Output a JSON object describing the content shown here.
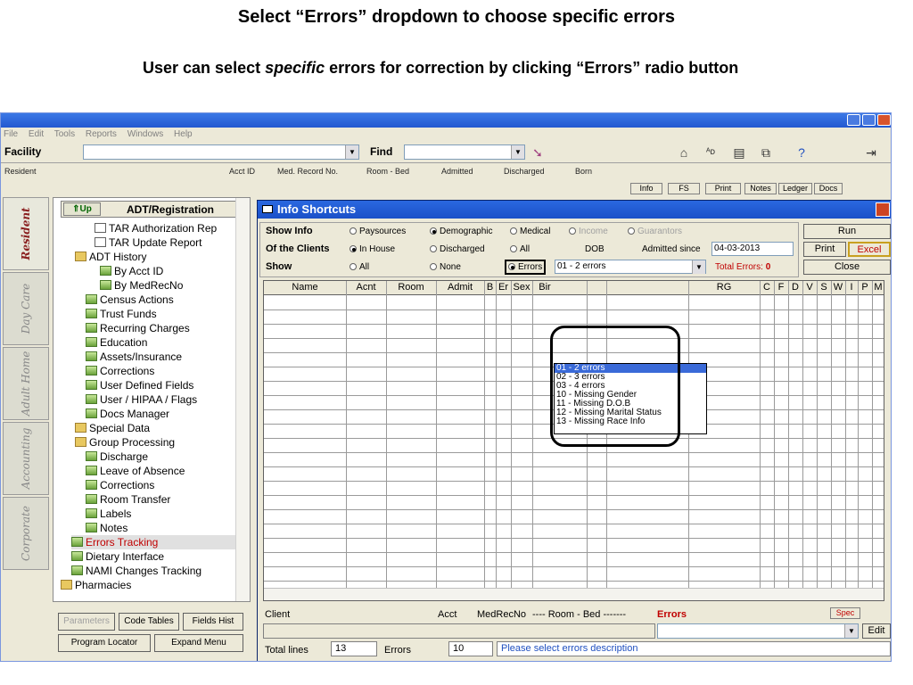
{
  "slide": {
    "title": "Select “Errors” dropdown to choose specific errors",
    "subtitle_pre": "User can select ",
    "subtitle_em": "specific",
    "subtitle_post": " errors for correction by clicking “Errors” radio button"
  },
  "menu": [
    "File",
    "Edit",
    "Tools",
    "Reports",
    "Windows",
    "Help"
  ],
  "toolbar": {
    "facility_label": "Facility",
    "find_label": "Find",
    "facility_value": "",
    "find_value": ""
  },
  "resident_header": [
    "Resident",
    "Acct ID",
    "Med. Record No.",
    "Room - Bed",
    "Admitted",
    "Discharged",
    "Born"
  ],
  "small_buttons": [
    "Info",
    "FS",
    "Print",
    "Notes",
    "Ledger",
    "Docs"
  ],
  "vtabs": [
    "Resident",
    "Day Care",
    "Adult Home",
    "Accounting",
    "Corporate"
  ],
  "tree": {
    "up_label": "⇑Up",
    "title": "ADT/Registration",
    "items": [
      "TAR Authorization Rep",
      "TAR Update Report",
      "ADT History",
      "By Acct ID",
      "By MedRecNo",
      "Census Actions",
      "Trust Funds",
      "Recurring Charges",
      "Education",
      "Assets/Insurance",
      "Corrections",
      "User Defined Fields",
      "User / HIPAA / Flags",
      "Docs Manager",
      "Special Data",
      "Group Processing",
      "Discharge",
      "Leave of Absence",
      "Corrections",
      "Room Transfer",
      "Labels",
      "Notes",
      "Errors Tracking",
      "Dietary Interface",
      "NAMI Changes Tracking",
      "Pharmacies"
    ]
  },
  "left_buttons": [
    "Parameters",
    "Code Tables",
    "Fields Hist",
    "Program Locator",
    "Expand Menu"
  ],
  "panel": {
    "title": "Info Shortcuts",
    "show_info_label": "Show Info",
    "show_info_options": [
      "Paysources",
      "Demographic",
      "Medical",
      "Income",
      "Guarantors"
    ],
    "clients_label": "Of the Clients",
    "clients_options": [
      "In House",
      "Discharged",
      "All"
    ],
    "dob_text": "DOB",
    "admitted_since_label": "Admitted since",
    "admitted_since_value": "04-03-2013",
    "show_label": "Show",
    "show_options": [
      "All",
      "None",
      "Errors"
    ],
    "errors_selected": "01 - 2 errors",
    "total_errors_label": "Total Errors:",
    "total_errors_value": "0",
    "run": "Run",
    "print": "Print",
    "excel": "Excel",
    "close": "Close"
  },
  "grid_headers": [
    "Name",
    "Acnt",
    "Room",
    "Admit",
    "B",
    "Er",
    "Sex",
    "Bir",
    "RG",
    "C",
    "F",
    "D",
    "V",
    "S",
    "W",
    "I",
    "P",
    "M"
  ],
  "dropdown_options": [
    "01 - 2 errors",
    "02 - 3 errors",
    "03 - 4 errors",
    "10 - Missing Gender",
    "11 - Missing D.O.B",
    "12 - Missing Marital Status",
    "13 - Missing Race Info"
  ],
  "bottom": {
    "client": "Client",
    "acct": "Acct",
    "medrecno": "MedRecNo",
    "roombed": "---- Room - Bed -------",
    "errors": "Errors",
    "spec": "Spec",
    "edit": "Edit",
    "total_lines_label": "Total lines",
    "total_lines_value": "13",
    "errors_label": "Errors",
    "errors_value": "10",
    "message": "Please select errors description"
  },
  "colors": {
    "accent": "#2a68e0",
    "error_red": "#c00000",
    "highlight": "#3a6ad8"
  }
}
